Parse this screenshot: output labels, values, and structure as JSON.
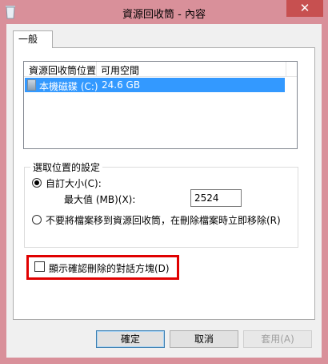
{
  "window": {
    "title": "資源回收筒 - 內容",
    "close_glyph": "✕"
  },
  "tabs": [
    {
      "label": "一般",
      "selected": true
    }
  ],
  "listview": {
    "columns": [
      "資源回收筒位置",
      "可用空間"
    ],
    "rows": [
      {
        "location": "本機磁碟 (C:)",
        "free_space": "24.6 GB",
        "selected": true
      }
    ]
  },
  "settings": {
    "group_title": "選取位置的設定",
    "custom_size_label": "自訂大小(C):",
    "max_size_label": "最大值 (MB)(X):",
    "max_size_value": "2524",
    "no_move_label": "不要將檔案移到資源回收筒，在刪除檔案時立即移除(R)",
    "custom_selected": true
  },
  "confirm_delete": {
    "label": "顯示確認刪除的對話方塊(D)",
    "checked": false
  },
  "buttons": {
    "ok": "確定",
    "cancel": "取消",
    "apply": "套用(A)"
  },
  "colors": {
    "accent_frame": "#d9909a",
    "selection": "#3399ff",
    "highlight_box": "#e00000",
    "close_button": "#c75050"
  }
}
